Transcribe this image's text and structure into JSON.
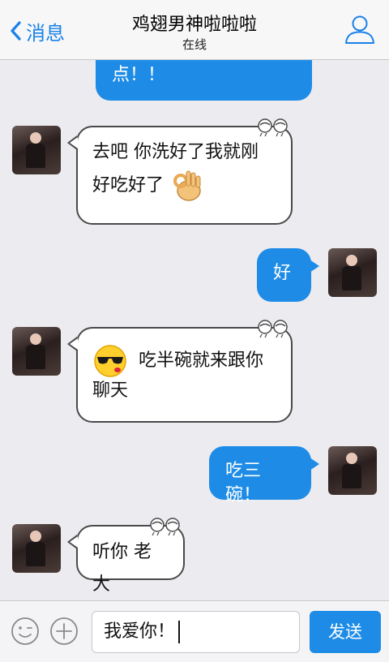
{
  "nav": {
    "back_label": "消息",
    "title": "鸡翅男神啦啦啦",
    "status": "在线"
  },
  "messages": [
    {
      "side": "out",
      "text": "点！！"
    },
    {
      "side": "in",
      "line1": "去吧 你洗好了我就刚",
      "line2": "好吃好了",
      "emoji": "ok-hand-emoji"
    },
    {
      "side": "out",
      "text": "好"
    },
    {
      "side": "in",
      "emoji": "sunglasses-kiss-emoji",
      "line1": "吃半碗就来跟你",
      "line2": "聊天"
    },
    {
      "side": "out",
      "text": "吃三碗！"
    },
    {
      "side": "in",
      "text": "听你 老大"
    }
  ],
  "input": {
    "value": "我爱你！",
    "send_label": "发送"
  },
  "colors": {
    "accent": "#1e8ce6",
    "chat_bg": "#ebebf0",
    "bubble_in_border": "#4a4a4a"
  }
}
